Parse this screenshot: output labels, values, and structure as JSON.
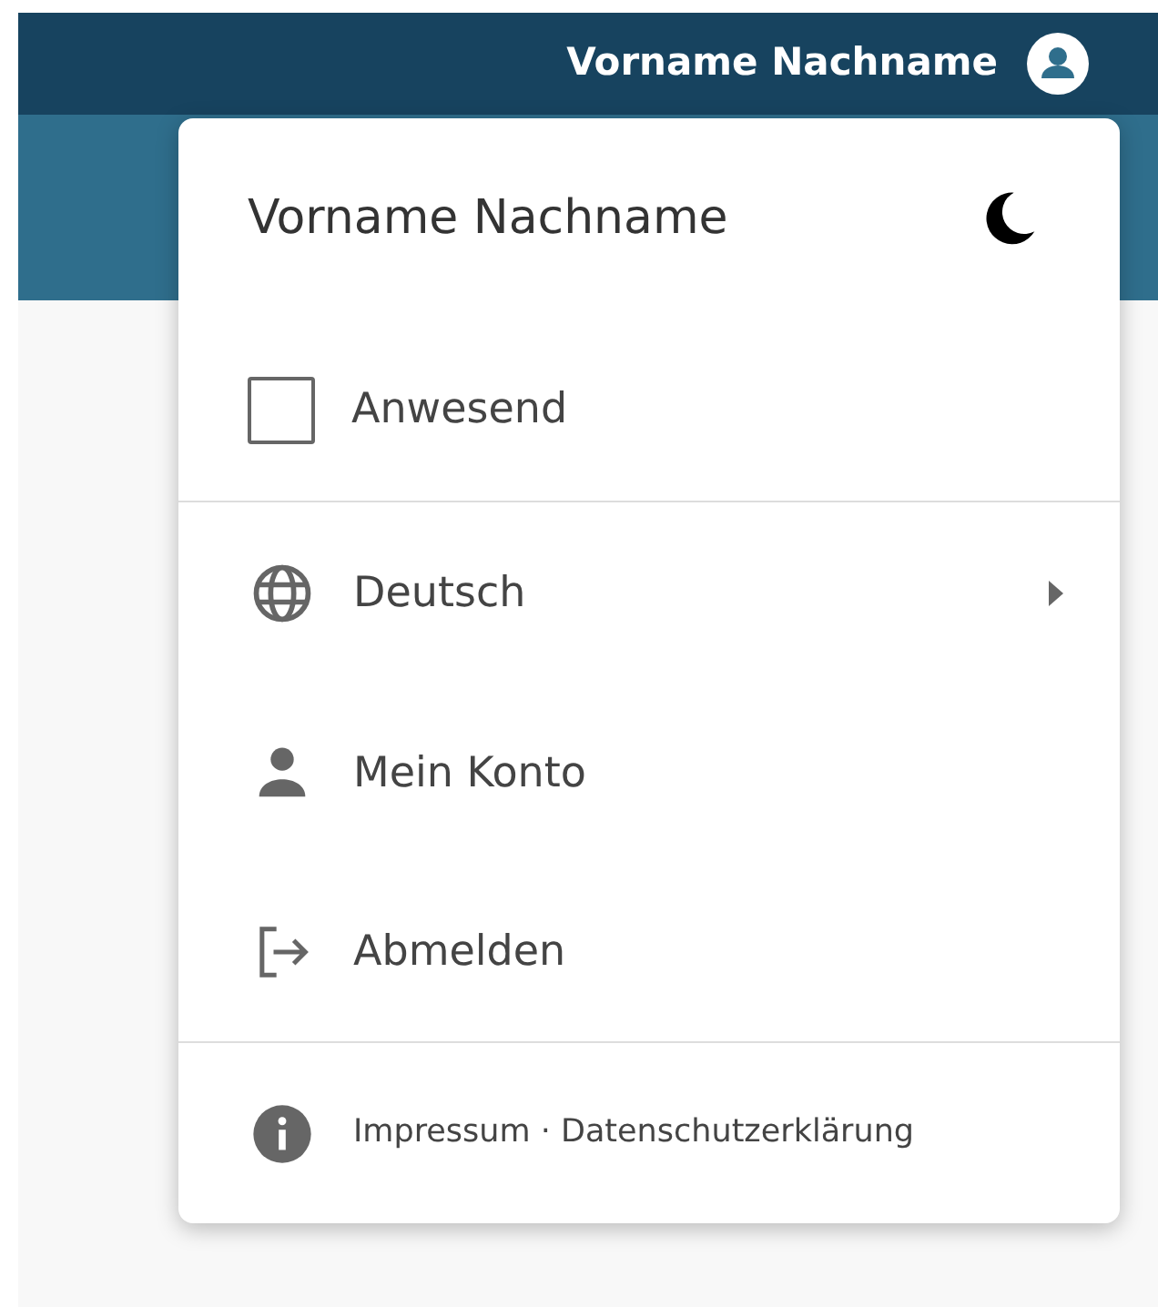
{
  "top_bar": {
    "user_name": "Vorname Nachname"
  },
  "menu": {
    "user_name": "Vorname Nachname",
    "sections": [
      [
        {
          "kind": "checkbox",
          "label": "Anwesend",
          "checked": false
        }
      ],
      [
        {
          "kind": "language",
          "label": "Deutsch",
          "submenu": true
        },
        {
          "kind": "account",
          "label": "Mein Konto",
          "submenu": false
        },
        {
          "kind": "logout",
          "label": "Abmelden",
          "submenu": false
        }
      ]
    ],
    "footer": {
      "links": [
        "Impressum",
        "Datenschutzerklärung"
      ],
      "separator": "·"
    }
  }
}
